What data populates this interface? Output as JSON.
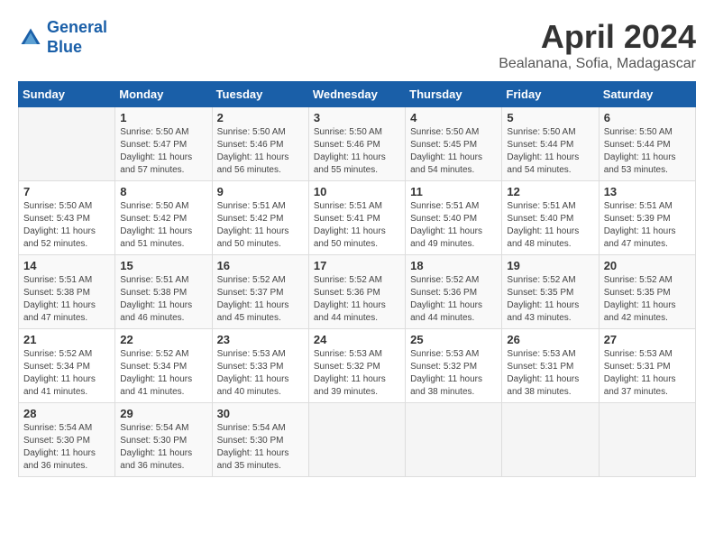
{
  "header": {
    "logo_line1": "General",
    "logo_line2": "Blue",
    "month_year": "April 2024",
    "location": "Bealanana, Sofia, Madagascar"
  },
  "calendar": {
    "weekdays": [
      "Sunday",
      "Monday",
      "Tuesday",
      "Wednesday",
      "Thursday",
      "Friday",
      "Saturday"
    ],
    "weeks": [
      [
        {
          "day": "",
          "info": ""
        },
        {
          "day": "1",
          "info": "Sunrise: 5:50 AM\nSunset: 5:47 PM\nDaylight: 11 hours\nand 57 minutes."
        },
        {
          "day": "2",
          "info": "Sunrise: 5:50 AM\nSunset: 5:46 PM\nDaylight: 11 hours\nand 56 minutes."
        },
        {
          "day": "3",
          "info": "Sunrise: 5:50 AM\nSunset: 5:46 PM\nDaylight: 11 hours\nand 55 minutes."
        },
        {
          "day": "4",
          "info": "Sunrise: 5:50 AM\nSunset: 5:45 PM\nDaylight: 11 hours\nand 54 minutes."
        },
        {
          "day": "5",
          "info": "Sunrise: 5:50 AM\nSunset: 5:44 PM\nDaylight: 11 hours\nand 54 minutes."
        },
        {
          "day": "6",
          "info": "Sunrise: 5:50 AM\nSunset: 5:44 PM\nDaylight: 11 hours\nand 53 minutes."
        }
      ],
      [
        {
          "day": "7",
          "info": "Sunrise: 5:50 AM\nSunset: 5:43 PM\nDaylight: 11 hours\nand 52 minutes."
        },
        {
          "day": "8",
          "info": "Sunrise: 5:50 AM\nSunset: 5:42 PM\nDaylight: 11 hours\nand 51 minutes."
        },
        {
          "day": "9",
          "info": "Sunrise: 5:51 AM\nSunset: 5:42 PM\nDaylight: 11 hours\nand 50 minutes."
        },
        {
          "day": "10",
          "info": "Sunrise: 5:51 AM\nSunset: 5:41 PM\nDaylight: 11 hours\nand 50 minutes."
        },
        {
          "day": "11",
          "info": "Sunrise: 5:51 AM\nSunset: 5:40 PM\nDaylight: 11 hours\nand 49 minutes."
        },
        {
          "day": "12",
          "info": "Sunrise: 5:51 AM\nSunset: 5:40 PM\nDaylight: 11 hours\nand 48 minutes."
        },
        {
          "day": "13",
          "info": "Sunrise: 5:51 AM\nSunset: 5:39 PM\nDaylight: 11 hours\nand 47 minutes."
        }
      ],
      [
        {
          "day": "14",
          "info": "Sunrise: 5:51 AM\nSunset: 5:38 PM\nDaylight: 11 hours\nand 47 minutes."
        },
        {
          "day": "15",
          "info": "Sunrise: 5:51 AM\nSunset: 5:38 PM\nDaylight: 11 hours\nand 46 minutes."
        },
        {
          "day": "16",
          "info": "Sunrise: 5:52 AM\nSunset: 5:37 PM\nDaylight: 11 hours\nand 45 minutes."
        },
        {
          "day": "17",
          "info": "Sunrise: 5:52 AM\nSunset: 5:36 PM\nDaylight: 11 hours\nand 44 minutes."
        },
        {
          "day": "18",
          "info": "Sunrise: 5:52 AM\nSunset: 5:36 PM\nDaylight: 11 hours\nand 44 minutes."
        },
        {
          "day": "19",
          "info": "Sunrise: 5:52 AM\nSunset: 5:35 PM\nDaylight: 11 hours\nand 43 minutes."
        },
        {
          "day": "20",
          "info": "Sunrise: 5:52 AM\nSunset: 5:35 PM\nDaylight: 11 hours\nand 42 minutes."
        }
      ],
      [
        {
          "day": "21",
          "info": "Sunrise: 5:52 AM\nSunset: 5:34 PM\nDaylight: 11 hours\nand 41 minutes."
        },
        {
          "day": "22",
          "info": "Sunrise: 5:52 AM\nSunset: 5:34 PM\nDaylight: 11 hours\nand 41 minutes."
        },
        {
          "day": "23",
          "info": "Sunrise: 5:53 AM\nSunset: 5:33 PM\nDaylight: 11 hours\nand 40 minutes."
        },
        {
          "day": "24",
          "info": "Sunrise: 5:53 AM\nSunset: 5:32 PM\nDaylight: 11 hours\nand 39 minutes."
        },
        {
          "day": "25",
          "info": "Sunrise: 5:53 AM\nSunset: 5:32 PM\nDaylight: 11 hours\nand 38 minutes."
        },
        {
          "day": "26",
          "info": "Sunrise: 5:53 AM\nSunset: 5:31 PM\nDaylight: 11 hours\nand 38 minutes."
        },
        {
          "day": "27",
          "info": "Sunrise: 5:53 AM\nSunset: 5:31 PM\nDaylight: 11 hours\nand 37 minutes."
        }
      ],
      [
        {
          "day": "28",
          "info": "Sunrise: 5:54 AM\nSunset: 5:30 PM\nDaylight: 11 hours\nand 36 minutes."
        },
        {
          "day": "29",
          "info": "Sunrise: 5:54 AM\nSunset: 5:30 PM\nDaylight: 11 hours\nand 36 minutes."
        },
        {
          "day": "30",
          "info": "Sunrise: 5:54 AM\nSunset: 5:30 PM\nDaylight: 11 hours\nand 35 minutes."
        },
        {
          "day": "",
          "info": ""
        },
        {
          "day": "",
          "info": ""
        },
        {
          "day": "",
          "info": ""
        },
        {
          "day": "",
          "info": ""
        }
      ]
    ]
  }
}
